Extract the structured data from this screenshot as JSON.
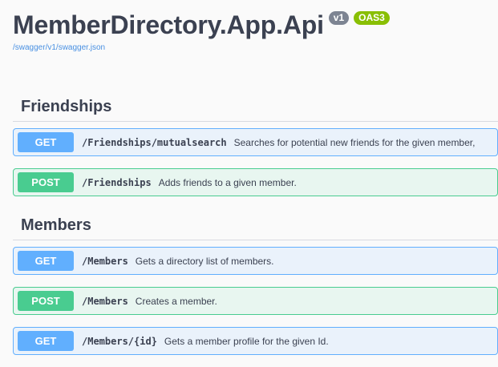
{
  "info": {
    "title": "MemberDirectory.App.Api",
    "version_badge": "v1",
    "oas_badge": "OAS3",
    "spec_link": "/swagger/v1/swagger.json"
  },
  "colors": {
    "get": "#61affe",
    "post": "#49cc90",
    "get_bg": "#eaf2fb",
    "post_bg": "#e8f6f0",
    "version_badge": "#7d8492",
    "oas_badge": "#89bf04",
    "link": "#4990e2"
  },
  "sections": [
    {
      "name": "Friendships",
      "operations": [
        {
          "method": "GET",
          "path": "/Friendships/mutualsearch",
          "summary": "Searches for potential new friends for the given member,"
        },
        {
          "method": "POST",
          "path": "/Friendships",
          "summary": "Adds friends to a given member."
        }
      ]
    },
    {
      "name": "Members",
      "operations": [
        {
          "method": "GET",
          "path": "/Members",
          "summary": "Gets a directory list of members."
        },
        {
          "method": "POST",
          "path": "/Members",
          "summary": "Creates a member."
        },
        {
          "method": "GET",
          "path": "/Members/{id}",
          "summary": "Gets a member profile for the given Id."
        }
      ]
    }
  ]
}
